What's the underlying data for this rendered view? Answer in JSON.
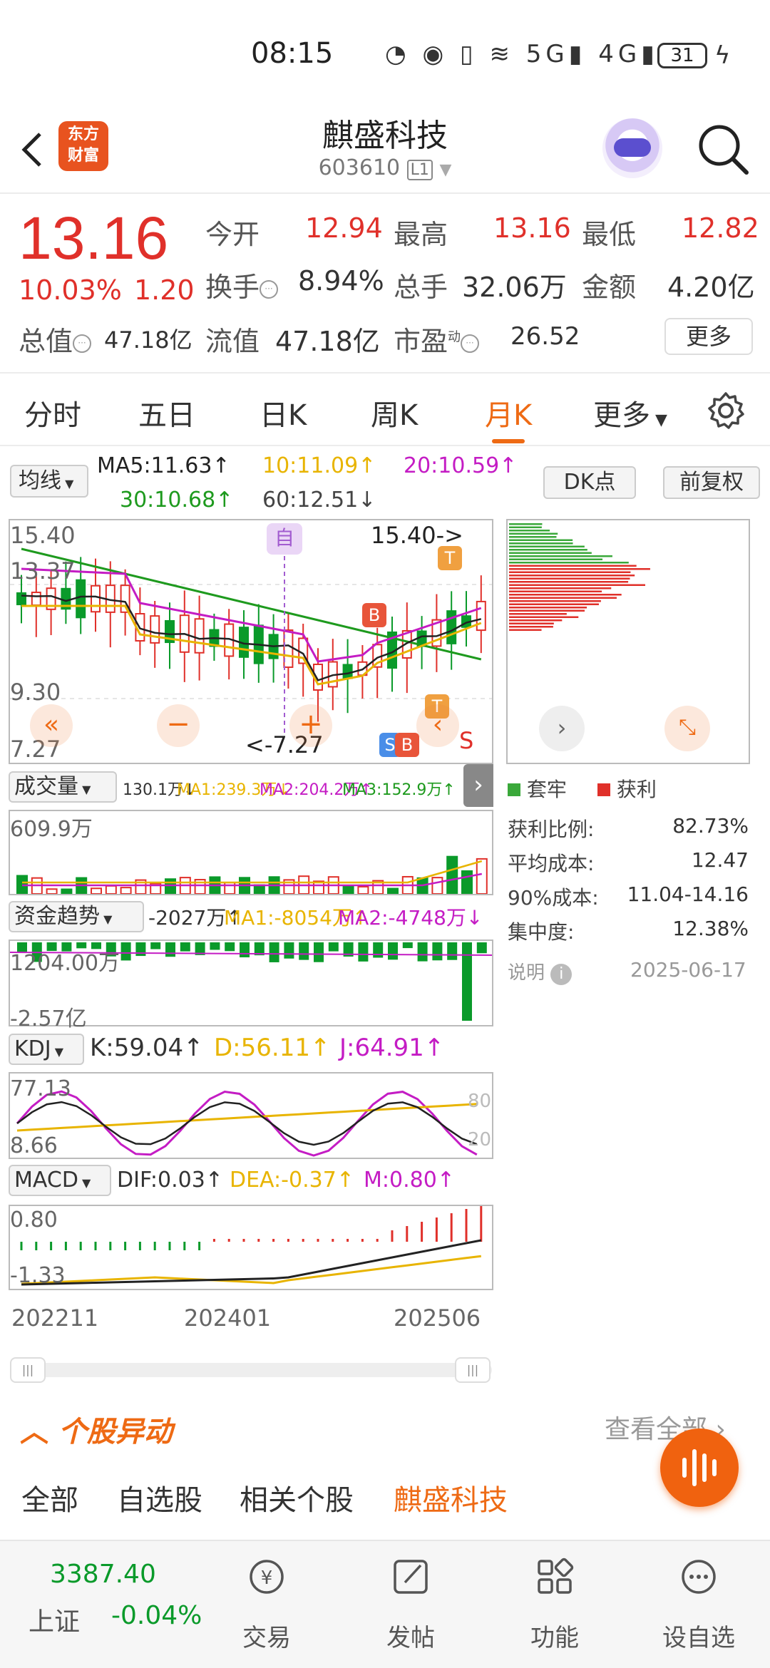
{
  "status": {
    "time": "08:15",
    "battery": "31"
  },
  "header": {
    "name": "麒盛科技",
    "code": "603610",
    "level": "L1",
    "logo_text": "东方\n财富"
  },
  "quote": {
    "price": "13.16",
    "chg_pct": "10.03%",
    "chg_abs": "1.20",
    "open_label": "今开",
    "open": "12.94",
    "high_label": "最高",
    "high": "13.16",
    "low_label": "最低",
    "low": "12.82",
    "turnover_label": "换手",
    "turnover": "8.94%",
    "volume_label": "总手",
    "volume": "32.06万",
    "amount_label": "金额",
    "amount": "4.20亿",
    "mktcap_label": "总值",
    "mktcap": "47.18亿",
    "float_label": "流值",
    "float": "47.18亿",
    "pe_label": "市盈",
    "pe_sup": "动",
    "pe": "26.52",
    "more": "更多"
  },
  "tabs": [
    "分时",
    "五日",
    "日K",
    "周K",
    "月K",
    "更多"
  ],
  "active_tab": "月K",
  "ma_legend": {
    "selector": "均线",
    "ma5": "MA5:11.63↑",
    "ma10": "10:11.09↑",
    "ma20": "20:10.59↑",
    "ma30": "30:10.68↑",
    "ma60": "60:12.51↓",
    "dk": "DK点",
    "adjust": "前复权"
  },
  "kline_axis": {
    "top": "15.40",
    "mid1": "13.37",
    "mid2": "9.30",
    "bottom": "7.27",
    "high_mark": "15.40->",
    "low_mark": "<-7.27",
    "zi": "自"
  },
  "markers": {
    "b": "B",
    "s": "S",
    "t": "T"
  },
  "cost_legend": {
    "trapped": "套牢",
    "profit": "获利"
  },
  "cost_stats": [
    {
      "label": "获利比例:",
      "value": "82.73%"
    },
    {
      "label": "平均成本:",
      "value": "12.47"
    },
    {
      "label": "90%成本:",
      "value": "11.04-14.16"
    },
    {
      "label": "集中度:",
      "value": "12.38%"
    }
  ],
  "cost_note": {
    "label": "说明",
    "date": "2025-06-17"
  },
  "volume": {
    "selector": "成交量",
    "legend": [
      "130.1万↓",
      "MA1:239.3万↓",
      "MA2:204.2万↑",
      "MA3:152.9万↑"
    ],
    "top": "609.9万"
  },
  "fund": {
    "selector": "资金趋势",
    "legend": [
      "-2027万↑",
      "MA1:-8054万↑",
      "MA2:-4748万↓"
    ],
    "top": "1204.00万",
    "bottom": "-2.57亿"
  },
  "kdj": {
    "selector": "KDJ",
    "k": "K:59.04↑",
    "d": "D:56.11↑",
    "j": "J:64.91↑",
    "top": "77.13",
    "bottom": "8.66",
    "r80": "80",
    "r20": "20"
  },
  "macd": {
    "selector": "MACD",
    "dif": "DIF:0.03↑",
    "dea": "DEA:-0.37↑",
    "m": "M:0.80↑",
    "top": "0.80",
    "bottom": "-1.33"
  },
  "x_axis": [
    "202211",
    "202401",
    "202506"
  ],
  "section": {
    "title": "个股异动",
    "view_all": "查看全部"
  },
  "filters": [
    "全部",
    "自选股",
    "相关个股",
    "麒盛科技"
  ],
  "active_filter": "麒盛科技",
  "bottom_nav": {
    "index_name": "上证",
    "index_value": "3387.40",
    "index_chg": "-0.04%",
    "items": [
      "交易",
      "发帖",
      "功能",
      "设自选"
    ]
  },
  "colors": {
    "up": "#e0302a",
    "down": "#0a9a2a",
    "accent": "#ee6a14",
    "ma5": "#222222",
    "ma10": "#e8b400",
    "ma20": "#c41cc4",
    "ma30": "#1e9a1e"
  }
}
